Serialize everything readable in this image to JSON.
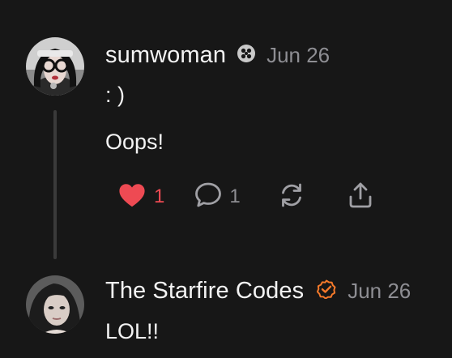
{
  "colors": {
    "background": "#171717",
    "text": "#f3f3f3",
    "muted": "#8e8e93",
    "like_active": "#ee4a53",
    "verified_orange": "#f5792a",
    "thread_line": "#3a3a3a"
  },
  "posts": [
    {
      "username": "sumwoman",
      "badge_icon": "community-badge-icon",
      "date": "Jun 26",
      "lines": [
        ": )",
        "Oops!"
      ],
      "actions": {
        "like_count": "1",
        "comment_count": "1",
        "like_icon": "heart-icon",
        "comment_icon": "comment-icon",
        "repost_icon": "repost-icon",
        "share_icon": "share-icon"
      }
    },
    {
      "username": "The Starfire Codes",
      "badge_icon": "verified-check-icon",
      "date": "Jun 26",
      "lines": [
        "LOL!!"
      ]
    }
  ]
}
